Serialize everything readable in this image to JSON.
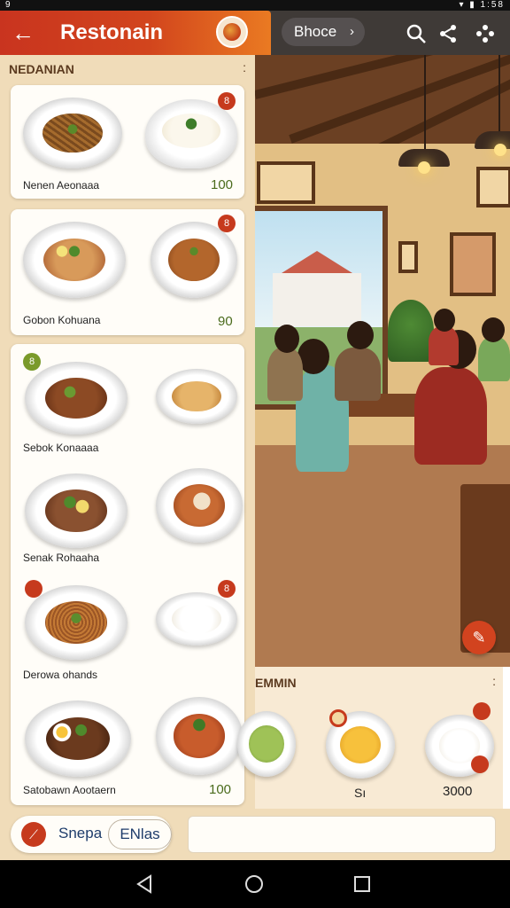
{
  "status": {
    "left": "9",
    "right": "▾ ▮ 1:58"
  },
  "app": {
    "back_glyph": "←",
    "title": "Restonain",
    "choose_label": "Bhoce",
    "choose_chevron": "›"
  },
  "panel": {
    "heading": "NEDANIAN",
    "more": ":"
  },
  "cards": [
    {
      "name": "Nenen Aeonaaa",
      "price": "100",
      "badge": "8"
    },
    {
      "name": "Gobon Kohuana",
      "price": "90",
      "badge": "8"
    },
    {
      "name": "Sebok Konaaaa",
      "badge": "8"
    },
    {
      "name": "Senak Rohaaha"
    },
    {
      "name": "Derowa ohands",
      "badge": "8"
    },
    {
      "name": "Satobawn Aootaern",
      "price": "100"
    }
  ],
  "bottom_card": {
    "heading": "EMMIN",
    "more": ":",
    "label_left": "Sı",
    "price": "3000"
  },
  "bottom_bar": {
    "chip_label": "Snepa",
    "chip_button": "ENlas",
    "input_placeholder": ""
  },
  "colors": {
    "accent": "#c9341f",
    "appbar": "#3f3a37",
    "panel": "#f0dcb9",
    "price": "#4a6b1c"
  }
}
